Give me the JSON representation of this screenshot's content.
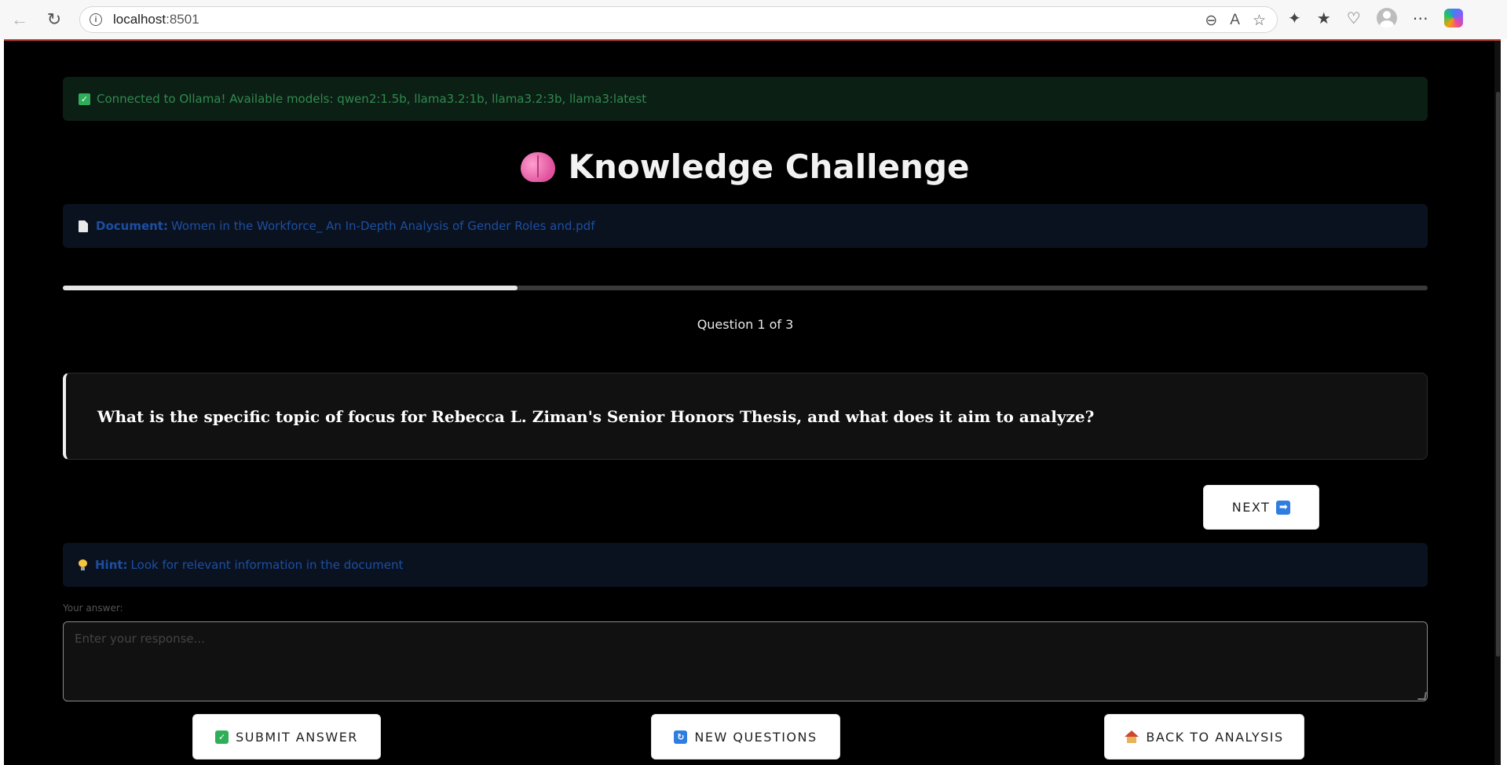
{
  "browser": {
    "url_host": "localhost",
    "url_port": ":8501"
  },
  "alerts": {
    "connection": "Connected to Ollama! Available models: qwen2:1.5b, llama3.2:1b, llama3.2:3b, llama3:latest",
    "document_label": "Document:",
    "document_name": "Women in the Workforce_ An In-Depth Analysis of Gender Roles and.pdf",
    "hint_label": "Hint:",
    "hint_text": "Look for relevant information in the document"
  },
  "header": {
    "title": "Knowledge Challenge"
  },
  "quiz": {
    "progress_fraction": 0.333,
    "question_counter": "Question 1 of 3",
    "question": "What is the specific topic of focus for Rebecca L. Ziman's Senior Honors Thesis, and what does it aim to analyze?",
    "next_label": "NEXT",
    "answer_label": "Your answer:",
    "answer_placeholder": "Enter your response...",
    "answer_value": ""
  },
  "actions": {
    "submit_label": "SUBMIT ANSWER",
    "new_questions_label": "NEW QUESTIONS",
    "back_label": "BACK TO ANALYSIS"
  },
  "icons": {
    "status": "check-icon",
    "document": "document-icon",
    "title": "brain-icon",
    "next": "arrow-right-icon",
    "hint": "lightbulb-icon",
    "submit": "check-icon",
    "new": "refresh-icon",
    "back": "house-icon"
  }
}
